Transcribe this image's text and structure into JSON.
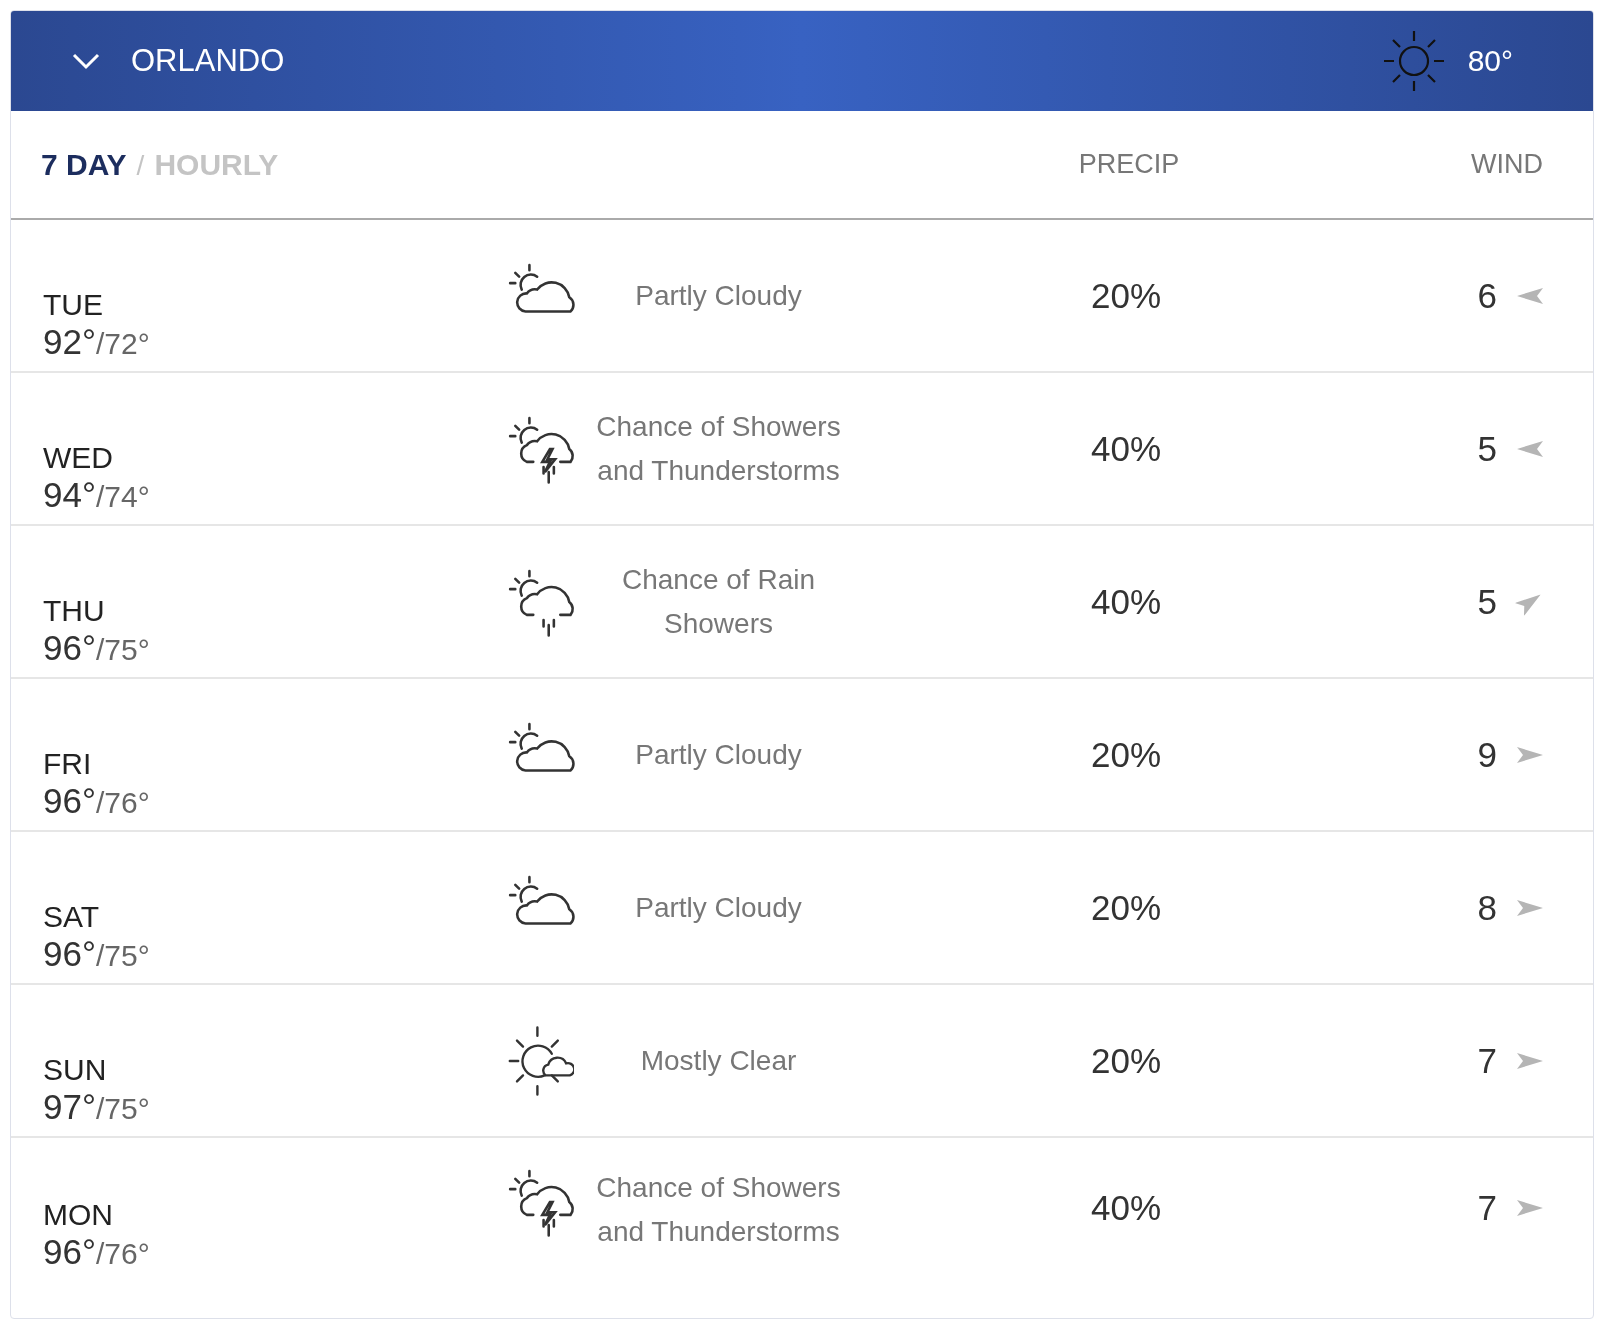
{
  "header": {
    "city": "ORLANDO",
    "current_temp": "80°"
  },
  "tabs": [
    {
      "label": "7 DAY",
      "selected": true
    },
    {
      "label": "HOURLY",
      "selected": false
    }
  ],
  "tab_separator": "/",
  "columns": {
    "precip": "PRECIP",
    "wind": "WIND"
  },
  "days": [
    {
      "day": "TUE",
      "high": "92°",
      "low": "/72°",
      "kind": "partly-cloudy",
      "condition": "Partly Cloudy",
      "precip": "20%",
      "wind": "6",
      "wind_arrow": {
        "kind": "west"
      }
    },
    {
      "day": "WED",
      "high": "94°",
      "low": "/74°",
      "kind": "thunderstorm",
      "condition": "Chance of Showers and Thunderstorms",
      "precip": "40%",
      "wind": "5",
      "wind_arrow": {
        "kind": "west"
      }
    },
    {
      "day": "THU",
      "high": "96°",
      "low": "/75°",
      "kind": "rain",
      "condition": "Chance of Rain Showers",
      "precip": "40%",
      "wind": "5",
      "wind_arrow": {
        "kind": "northeast"
      }
    },
    {
      "day": "FRI",
      "high": "96°",
      "low": "/76°",
      "kind": "partly-cloudy",
      "condition": "Partly Cloudy",
      "precip": "20%",
      "wind": "9",
      "wind_arrow": {
        "kind": "east"
      }
    },
    {
      "day": "SAT",
      "high": "96°",
      "low": "/75°",
      "kind": "partly-cloudy",
      "condition": "Partly Cloudy",
      "precip": "20%",
      "wind": "8",
      "wind_arrow": {
        "kind": "east"
      }
    },
    {
      "day": "SUN",
      "high": "97°",
      "low": "/75°",
      "kind": "mostly-clear",
      "condition": "Mostly Clear",
      "precip": "20%",
      "wind": "7",
      "wind_arrow": {
        "kind": "east"
      }
    },
    {
      "day": "MON",
      "high": "96°",
      "low": "/76°",
      "kind": "thunderstorm",
      "condition": "Chance of Showers and Thunderstorms",
      "precip": "40%",
      "wind": "7",
      "wind_arrow": {
        "kind": "east"
      }
    }
  ]
}
